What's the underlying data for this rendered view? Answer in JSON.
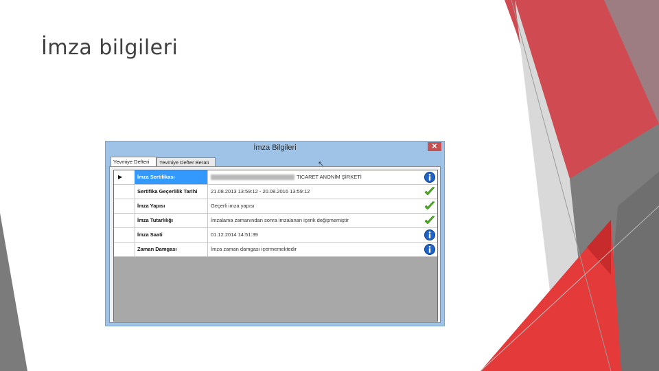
{
  "slide": {
    "title": "İmza bilgileri"
  },
  "window": {
    "title": "İmza Bilgileri",
    "close_label": "✕",
    "tabs": [
      {
        "label": "Yevmiye Defteri",
        "active": true
      },
      {
        "label": "Yevmiye Defter Beratı",
        "active": false
      }
    ]
  },
  "rows": [
    {
      "label": "İmza Sertifikası",
      "value": "TICARET ANONİM ŞİRKETİ",
      "status_icon": "info-icon",
      "selected": true
    },
    {
      "label": "Sertifika Geçerlilik Tarihi",
      "value": "21.08.2013 13:59:12 - 20.08.2016 13:59:12",
      "status_icon": "checkmark-icon",
      "selected": false
    },
    {
      "label": "İmza Yapısı",
      "value": "Geçerli imza yapısı",
      "status_icon": "checkmark-icon",
      "selected": false
    },
    {
      "label": "İmza Tutarlılığı",
      "value": "İmzalama zamanından sonra imzalanan içerik değişmemiştir",
      "status_icon": "checkmark-icon",
      "selected": false
    },
    {
      "label": "İmza Saati",
      "value": "01.12.2014 14:51:39",
      "status_icon": "info-icon",
      "selected": false
    },
    {
      "label": "Zaman Damgası",
      "value": "İmza zaman damgası içermemektedir",
      "status_icon": "info-icon",
      "selected": false
    }
  ],
  "colors": {
    "accent_red": "#e63946",
    "dark_red": "#b8323a",
    "grey": "#8c8c8c",
    "selection_blue": "#3399ff",
    "check_green": "#4caf20",
    "info_blue": "#1f63c6"
  }
}
